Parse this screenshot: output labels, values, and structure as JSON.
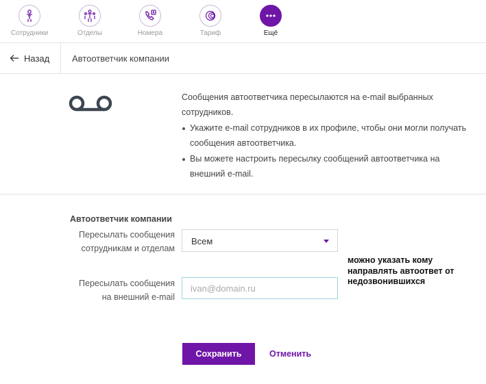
{
  "nav": {
    "items": [
      {
        "label": "Сотрудники",
        "icon": "person-icon"
      },
      {
        "label": "Отделы",
        "icon": "org-chart-icon"
      },
      {
        "label": "Номера",
        "icon": "phone-number-icon"
      },
      {
        "label": "Тариф",
        "icon": "tariff-icon"
      },
      {
        "label": "Ещё",
        "icon": "more-dots-icon",
        "active": true
      }
    ]
  },
  "subheader": {
    "back_label": "Назад",
    "title": "Автоответчик компании"
  },
  "info": {
    "icon": "voicemail-icon",
    "intro": "Сообщения автоответчика пересылаются на e-mail выбранных сотрудников.",
    "bullets": [
      "Укажите e-mail сотрудников в их профиле, чтобы они могли получать сообщения автоответчика.",
      "Вы можете настроить пересылку сообщений автоответчика на внешний e-mail."
    ]
  },
  "form": {
    "heading": "Автоответчик компании",
    "forward_label_line1": "Пересылать сообщения",
    "forward_label_line2": "сотрудникам и отделам",
    "forward_value": "Всем",
    "external_label_line1": "Пересылать сообщения",
    "external_label_line2": "на внешний e-mail",
    "external_placeholder": "ivan@domain.ru",
    "note": "можно указать кому направлять автоответ от недозвонившихся",
    "save_label": "Сохранить",
    "cancel_label": "Отменить"
  },
  "colors": {
    "accent": "#6f16a8",
    "input_focus_border": "#9ad3dd"
  }
}
